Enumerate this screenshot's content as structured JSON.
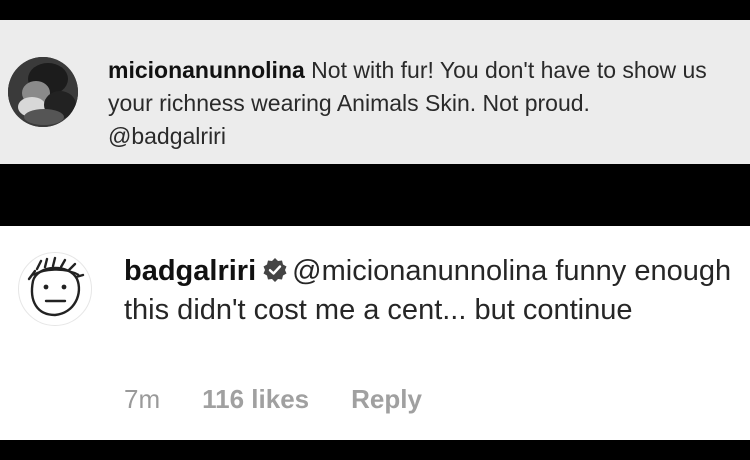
{
  "comment_1": {
    "username": "micionanunnolina",
    "text": "Not with fur! You don't have to show us your richness wearing Animals Skin. Not proud. @badgalriri",
    "avatar_icon": "profile-photo"
  },
  "comment_2": {
    "username": "badgalriri",
    "verified_icon": "verified-badge-icon",
    "text": "@micionanunnolina funny enough this didn't cost me a cent... but continue",
    "avatar_icon": "doodle-face-avatar",
    "time": "7m",
    "likes": "116 likes",
    "reply_label": "Reply"
  },
  "colors": {
    "background_bars": "#000000",
    "panel_1_bg": "#ececec",
    "panel_2_bg": "#ffffff",
    "meta_text": "#9a9a9a"
  }
}
